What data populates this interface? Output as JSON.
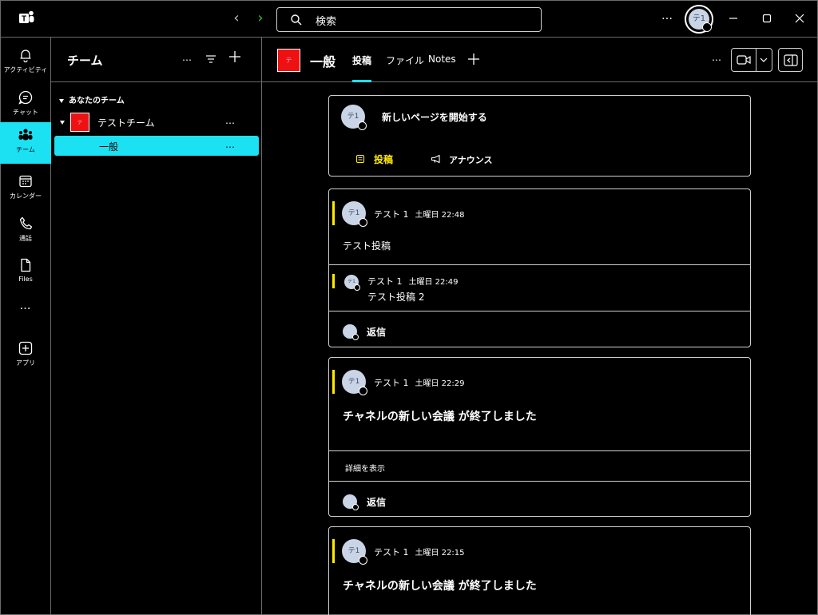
{
  "titlebar": {
    "search_placeholder": "検索",
    "more": "…",
    "me_initials": "テ1"
  },
  "rail": {
    "items": [
      {
        "label": "アクティビティ",
        "icon": "bell-icon"
      },
      {
        "label": "チャット",
        "icon": "chat-icon"
      },
      {
        "label": "チーム",
        "icon": "teams-icon"
      },
      {
        "label": "カレンダー",
        "icon": "calendar-icon"
      },
      {
        "label": "通話",
        "icon": "phone-icon"
      },
      {
        "label": "Files",
        "icon": "file-icon"
      },
      {
        "label": "…",
        "icon": "more-icon"
      },
      {
        "label": "アプリ",
        "icon": "add-app-icon"
      }
    ]
  },
  "teams_panel": {
    "title": "チーム",
    "more": "…",
    "section_label": "あなたのチーム",
    "team": {
      "name": "テストチーム",
      "initial": "テ",
      "more": "…"
    },
    "channel": {
      "name": "一般",
      "more": "…"
    }
  },
  "channel_header": {
    "initial": "テ",
    "title": "一般",
    "tabs": [
      {
        "label": "投稿",
        "active": true
      },
      {
        "label": "ファイル",
        "active": false
      },
      {
        "label": "Notes",
        "active": false
      }
    ],
    "more": "…"
  },
  "feed": {
    "new_post": {
      "avatar_initials": "テ1",
      "prompt": "新しいページを開始する",
      "post_button": "投稿",
      "announce_button": "アナウンス"
    },
    "posts": [
      {
        "avatar_initials": "テ1",
        "author": "テスト 1",
        "time": "土曜日 22:48",
        "text": "テスト投稿",
        "reply": {
          "avatar_initials": "テ1",
          "author": "テスト 1",
          "time": "土曜日 22:49",
          "text": "テスト投稿 2"
        },
        "reply_label": "返信"
      },
      {
        "avatar_initials": "テ1",
        "author": "テスト 1",
        "time": "土曜日 22:29",
        "text": "チャネルの新しい会議 が終了しました",
        "details_label": "詳細を表示",
        "reply_label": "返信"
      },
      {
        "avatar_initials": "テ1",
        "author": "テスト 1",
        "time": "土曜日 22:15",
        "text": "チャネルの新しい会議 が終了しました"
      }
    ]
  },
  "colors": {
    "accent": "#1be1f2",
    "highlight": "#ffeb00",
    "team_red": "#e11111",
    "border": "#d0d0d0"
  }
}
